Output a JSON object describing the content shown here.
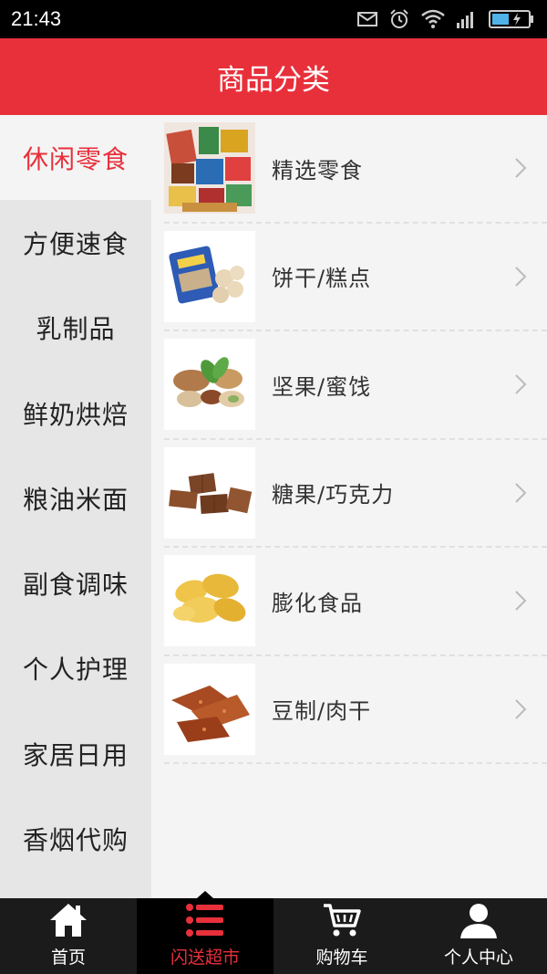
{
  "status_bar": {
    "time": "21:43"
  },
  "header": {
    "title": "商品分类"
  },
  "sidebar": {
    "items": [
      {
        "label": "休闲零食",
        "active": true
      },
      {
        "label": "方便速食"
      },
      {
        "label": "乳制品"
      },
      {
        "label": "鲜奶烘焙"
      },
      {
        "label": "粮油米面"
      },
      {
        "label": "副食调味"
      },
      {
        "label": "个人护理"
      },
      {
        "label": "家居日用"
      },
      {
        "label": "香烟代购"
      }
    ]
  },
  "categories": [
    {
      "label": "精选零食",
      "icon": "snacks-image"
    },
    {
      "label": "饼干/糕点",
      "icon": "biscuits-image"
    },
    {
      "label": "坚果/蜜饯",
      "icon": "nuts-image"
    },
    {
      "label": "糖果/巧克力",
      "icon": "chocolate-image"
    },
    {
      "label": "膨化食品",
      "icon": "chips-image"
    },
    {
      "label": "豆制/肉干",
      "icon": "jerky-image"
    }
  ],
  "tabbar": {
    "items": [
      {
        "label": "首页",
        "icon": "home-icon"
      },
      {
        "label": "闪送超市",
        "icon": "list-icon",
        "active": true
      },
      {
        "label": "购物车",
        "icon": "cart-icon"
      },
      {
        "label": "个人中心",
        "icon": "user-icon"
      }
    ]
  },
  "colors": {
    "accent": "#e8303b",
    "tabbar_bg": "#1b1b1b",
    "sidebar_bg": "#e6e6e6"
  }
}
